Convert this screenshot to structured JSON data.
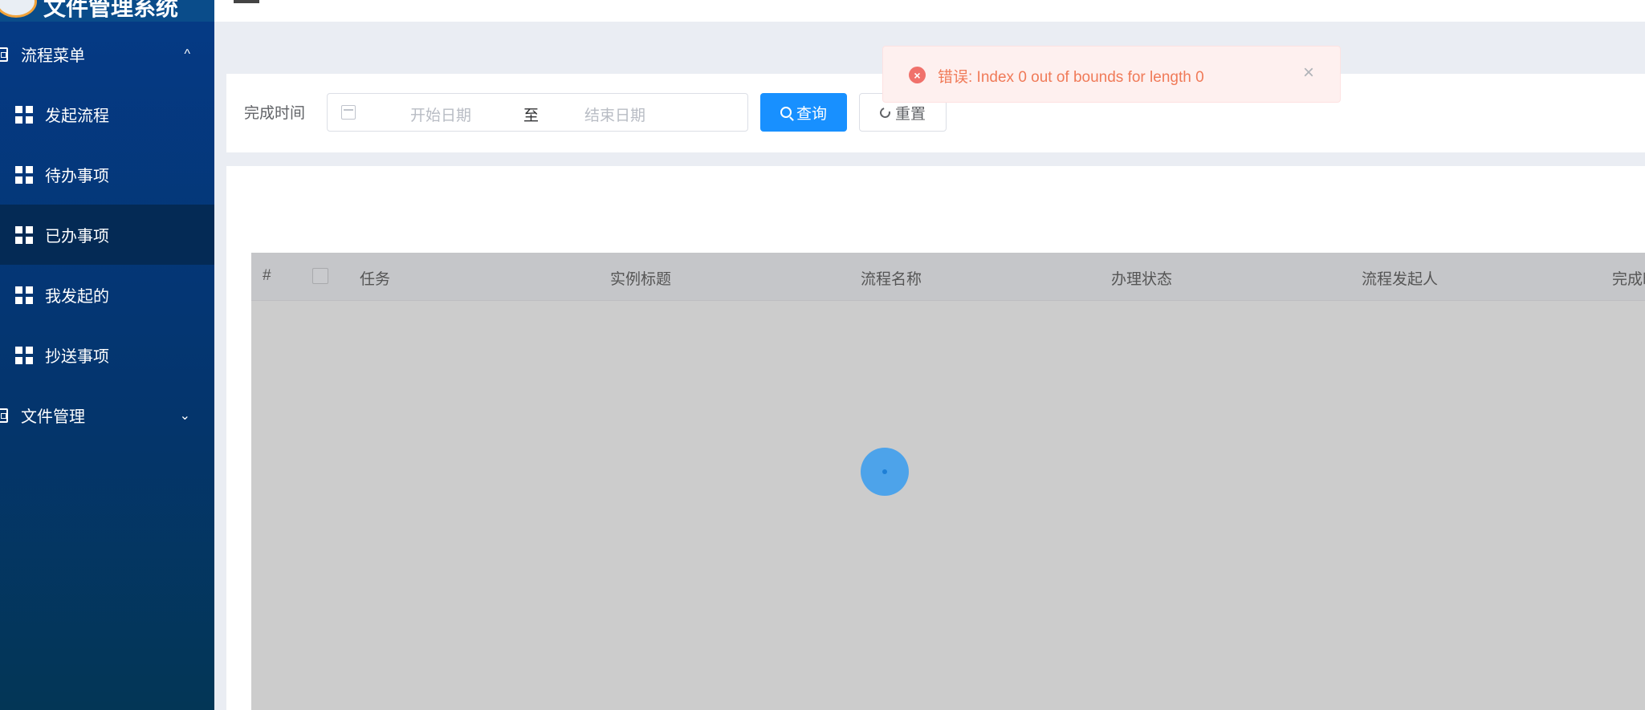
{
  "app": {
    "title": "文件管理系统"
  },
  "sidebar": {
    "groups": [
      {
        "label": "流程菜单",
        "chevron": "^"
      },
      {
        "label": "文件管理",
        "chevron": "⌄"
      }
    ],
    "items": [
      {
        "label": "发起流程"
      },
      {
        "label": "待办事项"
      },
      {
        "label": "已办事项",
        "active": true
      },
      {
        "label": "我发起的"
      },
      {
        "label": "抄送事项"
      }
    ]
  },
  "filter": {
    "label": "完成时间",
    "start_placeholder": "开始日期",
    "separator": "至",
    "end_placeholder": "结束日期",
    "query_label": "查询",
    "reset_label": "重置"
  },
  "table": {
    "columns": [
      "#",
      "任务",
      "实例标题",
      "流程名称",
      "办理状态",
      "流程发起人",
      "完成时"
    ]
  },
  "message": {
    "type": "error",
    "text": "错误: Index 0 out of bounds for length 0",
    "close": "×"
  },
  "colors": {
    "primary": "#1890ff",
    "sidebar": "#04356e",
    "error": "#f07a58"
  }
}
